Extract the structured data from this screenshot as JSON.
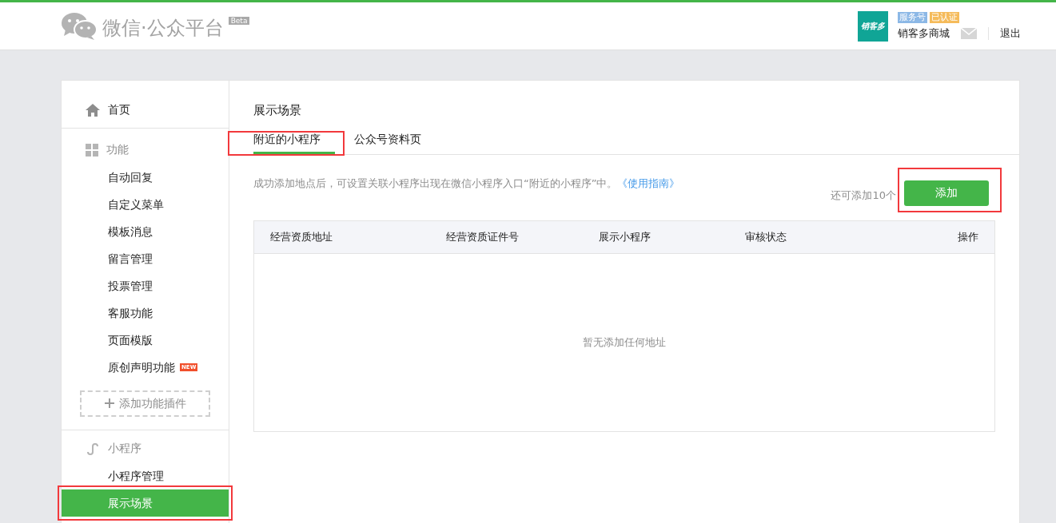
{
  "header": {
    "logo_text": "微信·公众平台",
    "beta_badge": "Beta",
    "avatar_text": "销客多",
    "account_tags": [
      {
        "label": "服务号",
        "color": "#8cb8e6"
      },
      {
        "label": "已认证",
        "color": "#f5bb5a"
      }
    ],
    "account_name": "销客多商城",
    "logout": "退出"
  },
  "sidebar": {
    "items": [
      {
        "kind": "home",
        "label": "首页"
      },
      {
        "kind": "feature-section",
        "label": "功能"
      },
      {
        "kind": "item",
        "label": "自动回复",
        "selected": false,
        "highlighted": false
      },
      {
        "kind": "item",
        "label": "自定义菜单",
        "selected": false,
        "highlighted": false
      },
      {
        "kind": "item",
        "label": "模板消息",
        "selected": false,
        "highlighted": false
      },
      {
        "kind": "item",
        "label": "留言管理",
        "selected": false,
        "highlighted": false
      },
      {
        "kind": "item",
        "label": "投票管理",
        "selected": false,
        "highlighted": false
      },
      {
        "kind": "item",
        "label": "客服功能",
        "selected": false,
        "highlighted": false
      },
      {
        "kind": "item",
        "label": "页面模版",
        "selected": false,
        "highlighted": false
      },
      {
        "kind": "item",
        "label": "原创声明功能",
        "badge": "NEW",
        "selected": false,
        "highlighted": false
      },
      {
        "kind": "plugin",
        "label": "添加功能插件"
      },
      {
        "kind": "program-section",
        "label": "小程序"
      },
      {
        "kind": "item",
        "label": "小程序管理",
        "selected": false,
        "highlighted": false
      },
      {
        "kind": "item",
        "label": "展示场景",
        "selected": true,
        "highlighted": true
      }
    ]
  },
  "main": {
    "title": "展示场景",
    "tabs": [
      {
        "label": "附近的小程序",
        "selected": true,
        "highlighted": true
      },
      {
        "label": "公众号资料页",
        "selected": false,
        "highlighted": false
      }
    ],
    "hint": "成功添加地点后，可设置关联小程序出现在微信小程序入口“附近的小程序”中。",
    "hint_link": "《使用指南》",
    "remaining": "还可添加10个",
    "add_button": {
      "label": "添加",
      "highlighted": true
    },
    "table": {
      "columns": [
        "经营资质地址",
        "经营资质证件号",
        "展示小程序",
        "审核状态",
        "操作"
      ],
      "empty_text": "暂无添加任何地址"
    }
  }
}
